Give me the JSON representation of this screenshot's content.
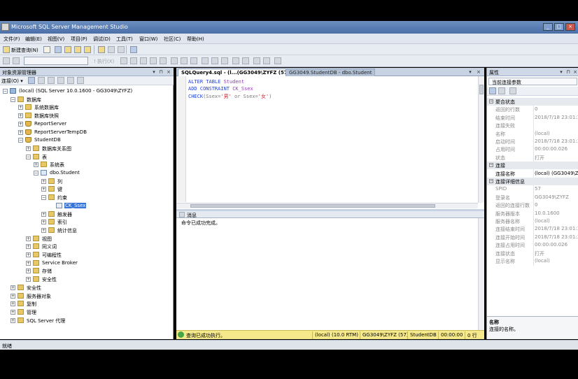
{
  "window": {
    "title": "Microsoft SQL Server Management Studio",
    "controls": [
      "minimize-icon",
      "maximize-icon",
      "close-icon"
    ]
  },
  "menu": [
    "文件(F)",
    "编辑(E)",
    "视图(V)",
    "项目(P)",
    "调试(D)",
    "工具(T)",
    "窗口(W)",
    "社区(C)",
    "帮助(H)"
  ],
  "toolbar": {
    "new_query": "新建查询(N)",
    "execute_hint": "! 执行(X)"
  },
  "object_explorer": {
    "title": "对象资源管理器",
    "connect_label": "连接(O) ▾",
    "tree": [
      {
        "label": "(local) (SQL Server 10.0.1600 - GG3049\\ZYFZ)",
        "icon": "server-icon",
        "exp": "−"
      },
      {
        "label": "数据库",
        "icon": "folder-icon",
        "exp": "−"
      },
      {
        "label": "系统数据库",
        "icon": "folder-icon",
        "exp": "+"
      },
      {
        "label": "数据库快照",
        "icon": "folder-icon",
        "exp": "+"
      },
      {
        "label": "ReportServer",
        "icon": "database-icon",
        "exp": "+"
      },
      {
        "label": "ReportServerTempDB",
        "icon": "database-icon",
        "exp": "+"
      },
      {
        "label": "StudentDB",
        "icon": "database-icon",
        "exp": "−"
      },
      {
        "label": "数据库关系图",
        "icon": "folder-icon",
        "exp": "+"
      },
      {
        "label": "表",
        "icon": "folder-icon",
        "exp": "−"
      },
      {
        "label": "系统表",
        "icon": "folder-icon",
        "exp": "+"
      },
      {
        "label": "dbo.Student",
        "icon": "table-icon",
        "exp": "−"
      },
      {
        "label": "列",
        "icon": "folder-icon",
        "exp": "+"
      },
      {
        "label": "键",
        "icon": "folder-icon",
        "exp": "+"
      },
      {
        "label": "约束",
        "icon": "folder-icon",
        "exp": "−"
      },
      {
        "label": "CK_Ssex",
        "icon": "constraint-icon",
        "exp": ""
      },
      {
        "label": "触发器",
        "icon": "folder-icon",
        "exp": "+"
      },
      {
        "label": "索引",
        "icon": "folder-icon",
        "exp": "+"
      },
      {
        "label": "统计信息",
        "icon": "folder-icon",
        "exp": "+"
      },
      {
        "label": "视图",
        "icon": "folder-icon",
        "exp": "+"
      },
      {
        "label": "同义词",
        "icon": "folder-icon",
        "exp": "+"
      },
      {
        "label": "可编程性",
        "icon": "folder-icon",
        "exp": "+"
      },
      {
        "label": "Service Broker",
        "icon": "folder-icon",
        "exp": "+"
      },
      {
        "label": "存储",
        "icon": "folder-icon",
        "exp": "+"
      },
      {
        "label": "安全性",
        "icon": "folder-icon",
        "exp": "+"
      },
      {
        "label": "安全性",
        "icon": "folder-icon",
        "exp": "+"
      },
      {
        "label": "服务器对象",
        "icon": "folder-icon",
        "exp": "+"
      },
      {
        "label": "复制",
        "icon": "folder-icon",
        "exp": "+"
      },
      {
        "label": "管理",
        "icon": "folder-icon",
        "exp": "+"
      },
      {
        "label": "SQL Server 代理",
        "icon": "folder-icon",
        "exp": "+"
      }
    ]
  },
  "editor": {
    "tabs": [
      {
        "label": "SQLQuery4.sql - (l...(GG3049\\ZYFZ (57))*",
        "active": true
      },
      {
        "label": "GG3049.StudentDB - dbo.Student",
        "active": false
      }
    ],
    "code": [
      [
        {
          "t": "ALTER TABLE ",
          "c": "kw"
        },
        {
          "t": "Student",
          "c": "id"
        }
      ],
      [
        {
          "t": "ADD CONSTRAINT ",
          "c": "kw"
        },
        {
          "t": "CK_Ssex",
          "c": "id"
        }
      ],
      [
        {
          "t": "CHECK",
          "c": "kw"
        },
        {
          "t": "(Ssex=",
          "c": "op"
        },
        {
          "t": "'男'",
          "c": "str"
        },
        {
          "t": " or ",
          "c": "op"
        },
        {
          "t": "Ssex=",
          "c": "op"
        },
        {
          "t": "'女'",
          "c": "str"
        },
        {
          "t": ")",
          "c": "op"
        }
      ]
    ]
  },
  "results": {
    "tab": "消息",
    "message": "命令已成功完成。"
  },
  "status_strip": {
    "message": "查询已成功执行。",
    "server": "(local) (10.0 RTM)",
    "user": "GG3049\\ZYFZ (57)",
    "database": "StudentDB",
    "elapsed": "00:00:00",
    "rows": "0 行"
  },
  "properties": {
    "title": "属性",
    "object": "当前连接参数",
    "rows": [
      {
        "kind": "cat",
        "label": "聚合状态"
      },
      {
        "name": "返回的行数",
        "value": "0"
      },
      {
        "name": "结束时间",
        "value": "2018/7/18 23:01:3"
      },
      {
        "name": "连接失败",
        "value": ""
      },
      {
        "name": "名称",
        "value": "(local)"
      },
      {
        "name": "启动时间",
        "value": "2018/7/18 23:01:3"
      },
      {
        "name": "占用时间",
        "value": "00:00:00.026"
      },
      {
        "name": "状态",
        "value": "打开"
      },
      {
        "kind": "cat",
        "label": "连接"
      },
      {
        "name": "连接名称",
        "value": "(local) (GG3049\\Z",
        "dark": true
      },
      {
        "kind": "cat",
        "label": "连接详细信息"
      },
      {
        "name": "SPID",
        "value": "57"
      },
      {
        "name": "登录名",
        "value": "GG3049\\ZYFZ"
      },
      {
        "name": "返回的连接行数",
        "value": "0"
      },
      {
        "name": "服务器版本",
        "value": "10.0.1600"
      },
      {
        "name": "服务器名称",
        "value": "(local)"
      },
      {
        "name": "连接结束时间",
        "value": "2018/7/18 23:01:3"
      },
      {
        "name": "连接开始时间",
        "value": "2018/7/18 23:01:3"
      },
      {
        "name": "连接占用时间",
        "value": "00:00:00.026"
      },
      {
        "name": "连接状态",
        "value": "打开"
      },
      {
        "name": "显示名称",
        "value": "(local)"
      }
    ],
    "desc_title": "名称",
    "desc_text": "连接的名称。"
  },
  "statusbar": {
    "text": "就绪"
  },
  "colors": {
    "titlebar": "#4a6fa8",
    "keyword": "#1f3fd1",
    "identifier": "#9a36c6",
    "string": "#d0202a",
    "status_strip": "#f6e98b",
    "selection": "#3875d7"
  }
}
